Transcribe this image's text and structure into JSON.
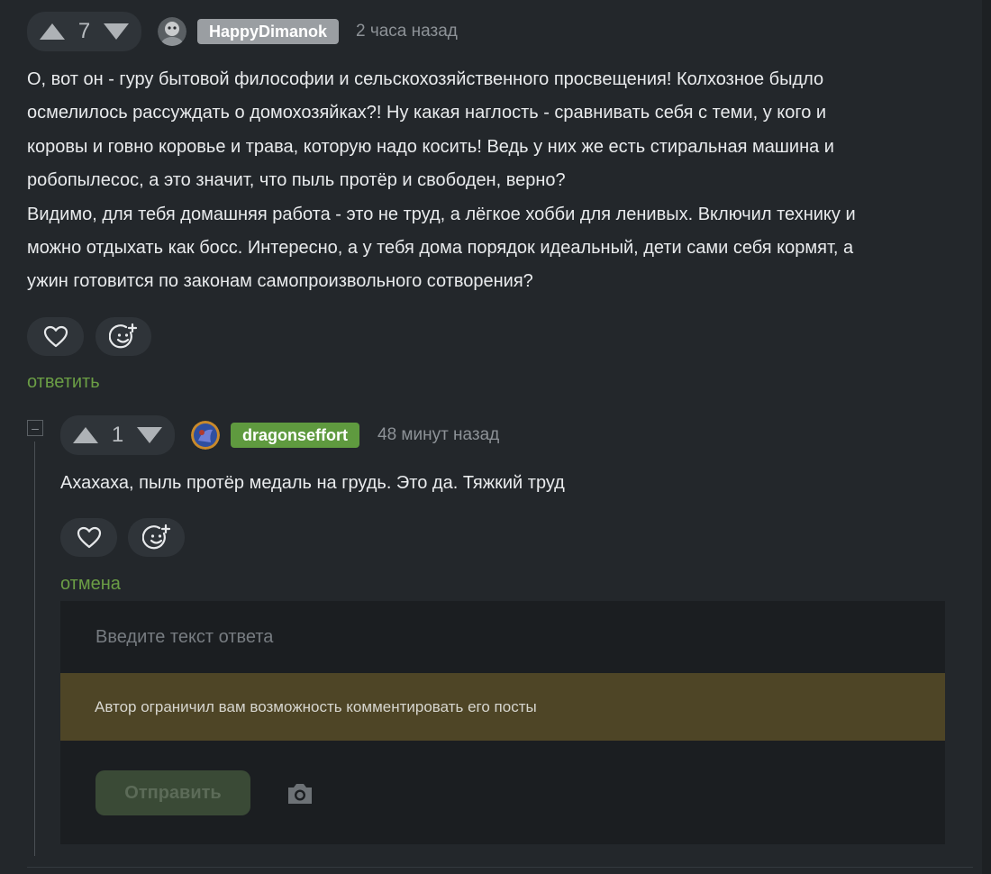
{
  "comment": {
    "votes": "7",
    "username": "HappyDimanok",
    "username_color": "#9a9ea2",
    "time": "2 часа назад",
    "lines": [
      "О, вот он - гуру бытовой философии и сельскохозяйственного просвещения! Колхозное быдло",
      "осмелилось рассуждать о домохозяйках?! Ну какая наглость - сравнивать себя с теми, у кого и",
      "коровы и говно коровье и трава, которую надо косить! Ведь у них же есть стиральная машина и",
      "робопылесос, а это значит, что пыль протёр и свободен, верно?",
      "Видимо, для тебя домашняя работа - это не труд, а лёгкое хобби для ленивых. Включил технику и",
      "можно отдыхать как босс. Интересно, а у тебя дома порядок идеальный, дети сами себя кормят, а",
      "ужин готовится по законам самопроизвольного сотворения?"
    ],
    "reply_label": "ответить"
  },
  "reply": {
    "votes": "1",
    "username": "dragonseffort",
    "username_color": "#5f9a3f",
    "time": "48 минут назад",
    "text": "Ахахаха, пыль протёр медаль на грудь. Это да. Тяжкий труд",
    "cancel_label": "отмена",
    "collapse_symbol": "–"
  },
  "reply_form": {
    "placeholder": "Введите текст ответа",
    "notice": "Автор ограничил вам возможность комментировать его посты",
    "send_label": "Отправить"
  },
  "icons": {
    "upvote": "triangle-up-icon",
    "downvote": "triangle-down-icon",
    "like": "heart-icon",
    "reaction": "emoji-add-icon",
    "attach": "camera-icon"
  },
  "colors": {
    "accent_green": "#6b9e45",
    "background": "#23272b",
    "notice_bg": "#4e4526"
  }
}
